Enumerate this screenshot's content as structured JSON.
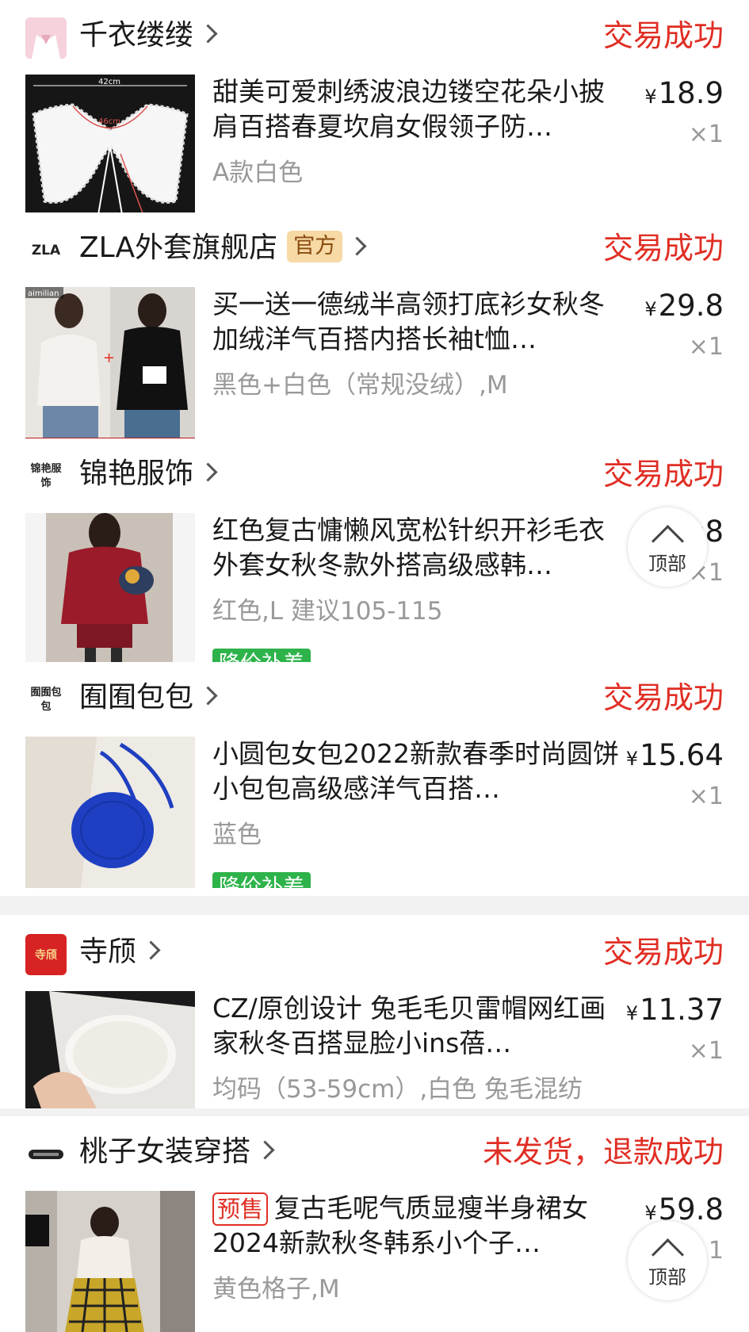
{
  "orders": [
    {
      "shop": "千衣缕缕",
      "official": "",
      "status": "交易成功",
      "title": "甜美可爱刺绣波浪边镂空花朵小披肩百搭春夏坎肩女假领子防…",
      "presale": "",
      "sku": "A款白色",
      "price": "18.9",
      "qty": "×1",
      "badge": "",
      "thumb_text": [
        "42cm",
        "46cm"
      ]
    },
    {
      "shop": "ZLA外套旗舰店",
      "official": "官方",
      "status": "交易成功",
      "title": "买一送一德绒半高领打底衫女秋冬加绒洋气百搭内搭长袖t恤…",
      "presale": "",
      "sku": "黑色+白色（常规没绒）,M",
      "price": "29.8",
      "qty": "×1",
      "badge": "",
      "logo_text": "ZLA",
      "thumb_text": [
        "aimilian"
      ]
    },
    {
      "shop": "锦艳服饰",
      "official": "",
      "status": "交易成功",
      "title": "红色复古慵懒风宽松针织开衫毛衣外套女秋冬款外搭高级感韩…",
      "presale": "",
      "sku": "红色,L 建议105-115",
      "price": "8",
      "qty": "×1",
      "badge": "降价补差",
      "logo_text": "锦艳服饰"
    },
    {
      "shop": "囿囿包包",
      "official": "",
      "status": "交易成功",
      "title": "小圆包女包2022新款春季时尚圆饼小包包高级感洋气百搭…",
      "presale": "",
      "sku": "蓝色",
      "price": "15.64",
      "qty": "×1",
      "badge": "降价补差",
      "logo_text": "囿囿包包"
    },
    {
      "shop": "寺颀",
      "official": "",
      "status": "交易成功",
      "title": "CZ/原创设计 兔毛毛贝雷帽网红画家秋冬百搭显脸小ins蓓…",
      "presale": "",
      "sku": "均码（53-59cm）,白色 兔毛混纺",
      "price": "11.37",
      "qty": "×1",
      "badge": "",
      "logo_text": "寺颀"
    },
    {
      "shop": "桃子女装穿搭",
      "official": "",
      "status": "未发货，退款成功",
      "title": "复古毛呢气质显瘦半身裙女2024新款秋冬韩系小个子…",
      "presale": "预售",
      "sku": "黄色格子,M",
      "price": "59.8",
      "qty": "1",
      "badge": ""
    }
  ],
  "currency": "¥",
  "back_to_top": "顶部",
  "colors": {
    "status": "#e02e24",
    "badge": "#2eb34b",
    "official_bg": "#f6d9a4"
  }
}
